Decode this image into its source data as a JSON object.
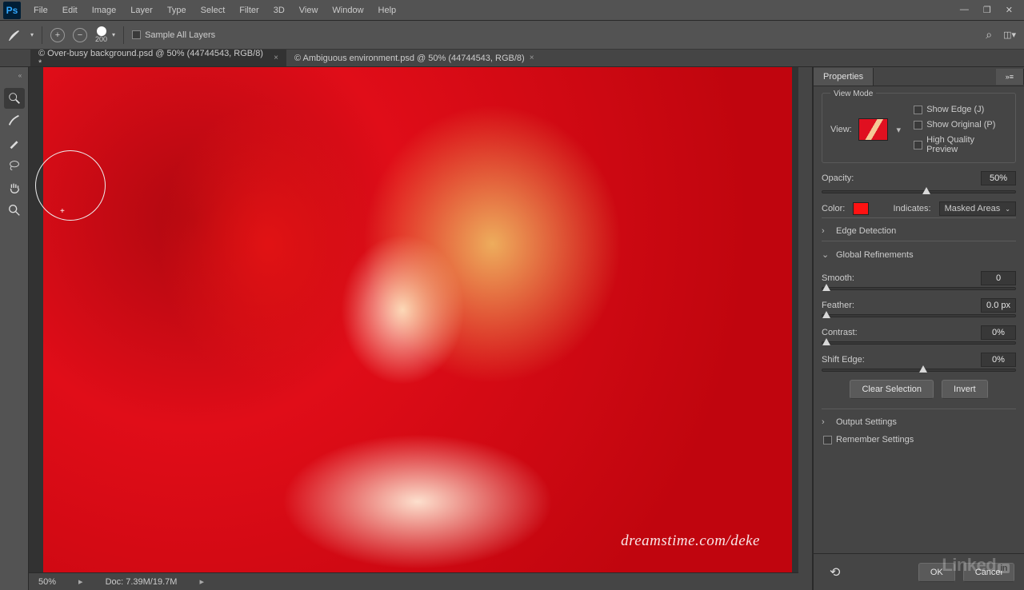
{
  "menu": [
    "File",
    "Edit",
    "Image",
    "Layer",
    "Type",
    "Select",
    "Filter",
    "3D",
    "View",
    "Window",
    "Help"
  ],
  "options": {
    "brush_size": "200",
    "sample_all": "Sample All Layers"
  },
  "tabs": [
    {
      "label": "© Over-busy background.psd @ 50% (44744543, RGB/8) *",
      "active": true
    },
    {
      "label": "© Ambiguous environment.psd @ 50% (44744543, RGB/8)",
      "active": false
    }
  ],
  "status": {
    "zoom": "50%",
    "doc": "Doc: 7.39M/19.7M"
  },
  "watermark": "dreamstime.com/deke",
  "props": {
    "tab": "Properties",
    "view_mode": {
      "title": "View Mode",
      "label": "View:",
      "opts": [
        "Show Edge (J)",
        "Show Original (P)",
        "High Quality Preview"
      ]
    },
    "opacity": {
      "label": "Opacity:",
      "value": "50%",
      "pos": 52
    },
    "color": {
      "label": "Color:",
      "indicates_label": "Indicates:",
      "indicates_value": "Masked Areas"
    },
    "edge": {
      "title": "Edge Detection"
    },
    "global": {
      "title": "Global Refinements",
      "smooth": {
        "label": "Smooth:",
        "value": "0",
        "pos": 0
      },
      "feather": {
        "label": "Feather:",
        "value": "0.0 px",
        "pos": 0
      },
      "contrast": {
        "label": "Contrast:",
        "value": "0%",
        "pos": 0
      },
      "shift": {
        "label": "Shift Edge:",
        "value": "0%",
        "pos": 50
      }
    },
    "clear": "Clear Selection",
    "invert": "Invert",
    "output": {
      "title": "Output Settings",
      "remember": "Remember Settings"
    },
    "ok": "OK",
    "cancel": "Cancel"
  }
}
